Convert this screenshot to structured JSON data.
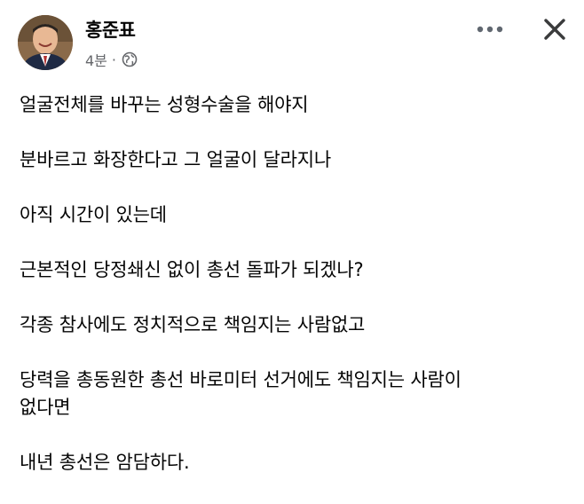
{
  "post": {
    "author_name": "홍준표",
    "timestamp": "4분",
    "separator": "·",
    "privacy_icon": "globe-icon",
    "more_icon": "more-horizontal-icon",
    "close_icon": "close-icon",
    "lines": [
      "얼굴전체를 바꾸는 성형수술을 해야지",
      "분바르고 화장한다고 그 얼굴이 달라지나",
      "아직 시간이 있는데",
      "근본적인 당정쇄신 없이 총선 돌파가 되겠나?",
      "각종 참사에도 정치적으로 책임지는 사람없고",
      "당력을 총동원한 총선 바로미터 선거에도 책임지는 사람이",
      "없다면",
      "내년 총선은 암담하다."
    ]
  }
}
